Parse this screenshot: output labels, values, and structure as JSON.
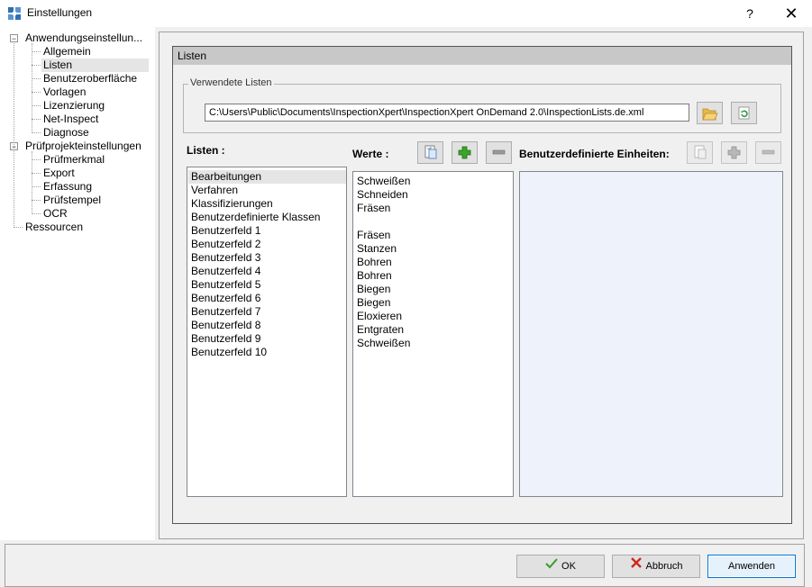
{
  "window": {
    "title": "Einstellungen",
    "help_label": "?",
    "close_label": "✕",
    "icon": "app-gear-icon"
  },
  "tree": {
    "items": [
      {
        "label": "Anwendungseinstellun...",
        "level": 0,
        "expanded": true
      },
      {
        "label": "Allgemein",
        "level": 1
      },
      {
        "label": "Listen",
        "level": 1,
        "selected": true
      },
      {
        "label": "Benutzeroberfläche",
        "level": 1
      },
      {
        "label": "Vorlagen",
        "level": 1
      },
      {
        "label": "Lizenzierung",
        "level": 1
      },
      {
        "label": "Net-Inspect",
        "level": 1
      },
      {
        "label": "Diagnose",
        "level": 1
      },
      {
        "label": "Prüfprojekteinstellungen",
        "level": 0,
        "expanded": true
      },
      {
        "label": "Prüfmerkmal",
        "level": 1
      },
      {
        "label": "Export",
        "level": 1
      },
      {
        "label": "Erfassung",
        "level": 1
      },
      {
        "label": "Prüfstempel",
        "level": 1
      },
      {
        "label": "OCR",
        "level": 1
      },
      {
        "label": "Ressourcen",
        "level": 0
      }
    ]
  },
  "panel": {
    "title": "Listen",
    "used_lists_label": "Verwendete Listen",
    "path_value": "C:\\Users\\Public\\Documents\\InspectionXpert\\InspectionXpert OnDemand 2.0\\InspectionLists.de.xml",
    "lists_label": "Listen :",
    "values_label": "Werte :",
    "units_label": "Benutzerdefinierte Einheiten:",
    "lists": [
      "Bearbeitungen",
      "Verfahren",
      "Klassifizierungen",
      "Benutzerdefinierte Klassen",
      "Benutzerfeld 1",
      "Benutzerfeld 2",
      "Benutzerfeld 3",
      "Benutzerfeld 4",
      "Benutzerfeld 5",
      "Benutzerfeld 6",
      "Benutzerfeld 7",
      "Benutzerfeld 8",
      "Benutzerfeld 9",
      "Benutzerfeld 10"
    ],
    "selected_list": "Bearbeitungen",
    "values": [
      "Schweißen",
      "Schneiden",
      "Fräsen",
      "",
      "Fräsen",
      "Stanzen",
      "Bohren",
      "Bohren",
      "Biegen",
      "Biegen",
      "Eloxieren",
      "Entgraten",
      "Schweißen"
    ]
  },
  "buttons": {
    "ok": "OK",
    "cancel": "Abbruch",
    "apply": "Anwenden"
  },
  "colors": {
    "units_list_bg": "#eef3fb",
    "ok_check": "#3a9a2a",
    "cancel_x": "#d0281e",
    "default_border": "#0078d7"
  }
}
